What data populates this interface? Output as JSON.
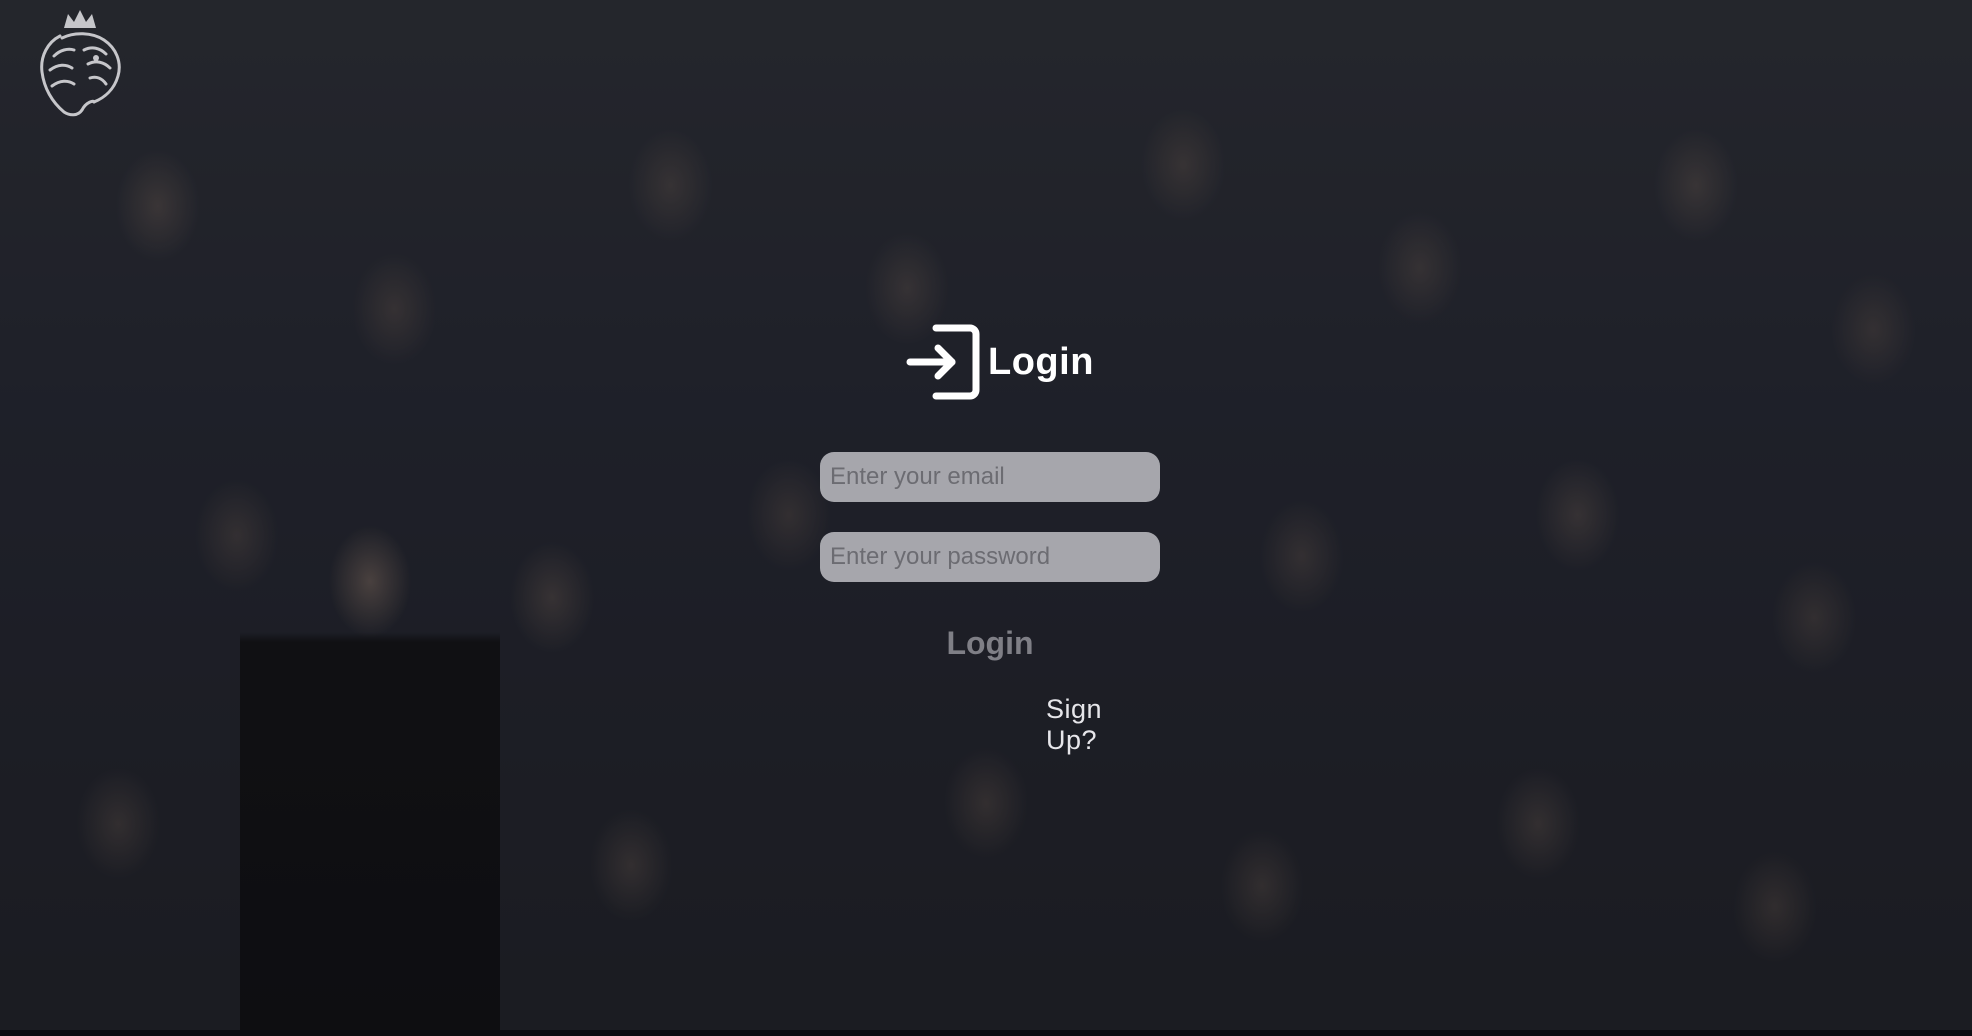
{
  "app": {
    "logo_icon": "premier-league-lion-icon"
  },
  "login": {
    "icon": "sign-in-icon",
    "title": "Login",
    "email": {
      "placeholder": "Enter your email",
      "value": ""
    },
    "password": {
      "placeholder": "Enter your password",
      "value": ""
    },
    "submit_label": "Login",
    "signup_label": "Sign Up?"
  },
  "colors": {
    "title": "#ffffff",
    "field_bg": "#cdcdd2",
    "button_text": "#7f7f86",
    "link_text": "#e6e6ea"
  }
}
